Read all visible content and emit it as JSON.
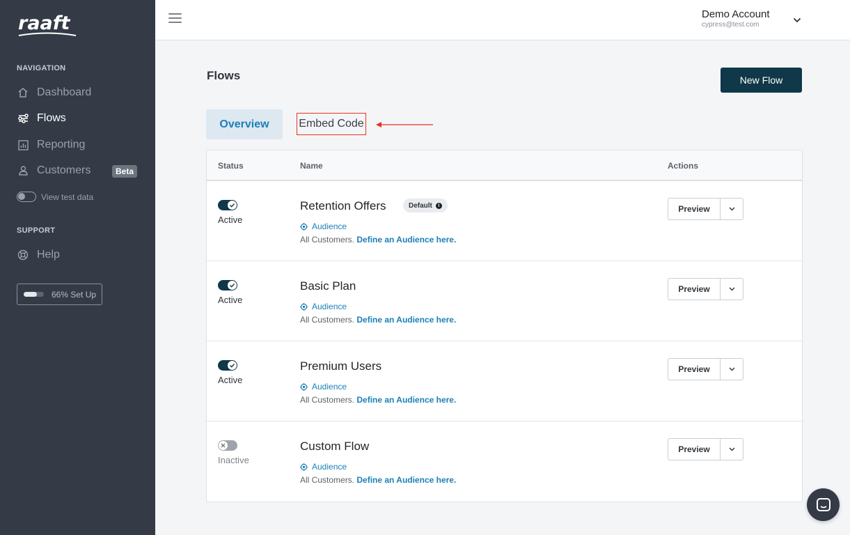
{
  "sidebar": {
    "logo": "raaft",
    "navigation_label": "NAVIGATION",
    "items": [
      {
        "label": "Dashboard",
        "icon": "home-icon",
        "active": false
      },
      {
        "label": "Flows",
        "icon": "flows-icon",
        "active": true
      },
      {
        "label": "Reporting",
        "icon": "reporting-icon",
        "active": false
      },
      {
        "label": "Customers",
        "icon": "user-icon",
        "active": false,
        "badge": "Beta"
      }
    ],
    "test_data_label": "View test data",
    "support_label": "SUPPORT",
    "help_label": "Help",
    "setup_label": "66% Set Up",
    "setup_progress": 0.66
  },
  "topbar": {
    "account_name": "Demo Account",
    "account_email": "cypress@test.com"
  },
  "page": {
    "title": "Flows",
    "new_flow_label": "New Flow",
    "tabs": [
      {
        "label": "Overview",
        "active": true
      },
      {
        "label": "Embed Code",
        "active": false
      }
    ]
  },
  "table": {
    "headers": {
      "status": "Status",
      "name": "Name",
      "actions": "Actions"
    },
    "rows": [
      {
        "status": "Active",
        "on": true,
        "name": "Retention Offers",
        "badge": "Default",
        "audience": "Audience",
        "desc": "All Customers.",
        "link": "Define an Audience here.",
        "preview": "Preview"
      },
      {
        "status": "Active",
        "on": true,
        "name": "Basic Plan",
        "audience": "Audience",
        "desc": "All Customers.",
        "link": "Define an Audience here.",
        "preview": "Preview"
      },
      {
        "status": "Active",
        "on": true,
        "name": "Premium Users",
        "audience": "Audience",
        "desc": "All Customers.",
        "link": "Define an Audience here.",
        "preview": "Preview"
      },
      {
        "status": "Inactive",
        "on": false,
        "name": "Custom Flow",
        "audience": "Audience",
        "desc": "All Customers.",
        "link": "Define an Audience here.",
        "preview": "Preview"
      }
    ]
  },
  "colors": {
    "sidebar_bg": "#343b47",
    "primary_dark": "#0f3848",
    "link_blue": "#1b7fb6",
    "annotation_red": "#e8311f"
  }
}
